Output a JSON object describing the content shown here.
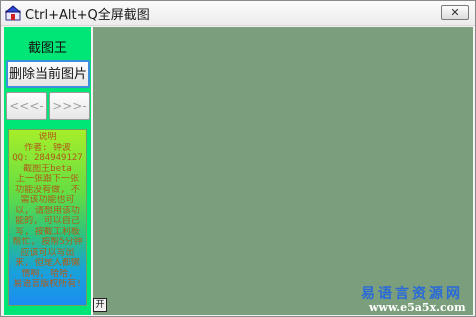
{
  "window": {
    "title": "Ctrl+Alt+Q全屏截图",
    "close_label": "✕"
  },
  "panel": {
    "title": "截图王",
    "delete_button": "删除当前图片",
    "prev_button": "<<<-",
    "next_button": ">>>-",
    "info_lines": [
      "说明",
      "作者: 钟波",
      "QQ: 284949127",
      "截图王beta",
      "上一张跟下一张",
      "功能没有做, 不",
      "需该功能也可",
      "以, 请想用该功",
      "能的, 可以自己",
      "写, 按截工利板",
      "帮忙, 按帮5分钟",
      "应该可以写出",
      "来, 但是人都懒",
      "惰啊, 哈哈,",
      "易语言版权所有!"
    ],
    "small_icon_label": "开"
  },
  "watermark": {
    "site_name": "易语言资源网",
    "url": "www.e5a5x.com"
  },
  "colors": {
    "panel_bg": "#00e676",
    "canvas_bg": "#7b9f7c",
    "accent": "#3d8fd9"
  }
}
